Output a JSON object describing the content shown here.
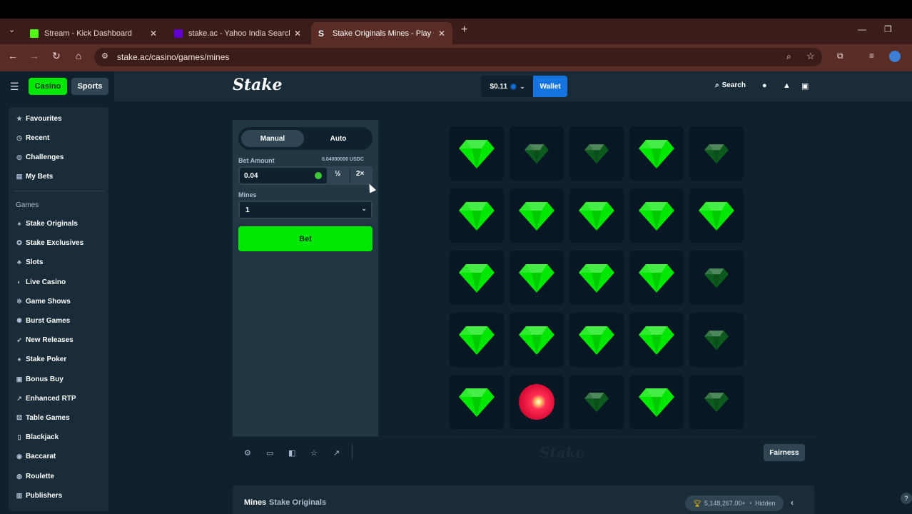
{
  "browser": {
    "tabs": [
      {
        "title": "Stream - Kick Dashboard",
        "favicon_color": "#53fc18",
        "active": false
      },
      {
        "title": "stake.ac - Yahoo India Search R",
        "favicon_color": "#6001d2",
        "active": false
      },
      {
        "title": "Stake Originals Mines - Play On",
        "favicon_color": "#ffffff",
        "active": true
      }
    ],
    "new_tab": "+",
    "url": "stake.ac/casino/games/mines"
  },
  "header": {
    "logo": "Stake",
    "balance": "$0.11",
    "wallet_label": "Wallet",
    "search_label": "Search"
  },
  "sidebar": {
    "top_buttons": [
      "Casino",
      "Sports"
    ],
    "quick": [
      {
        "label": "Favourites",
        "icon": "star-icon"
      },
      {
        "label": "Recent",
        "icon": "clock-icon"
      },
      {
        "label": "Challenges",
        "icon": "trophy-icon"
      },
      {
        "label": "My Bets",
        "icon": "list-icon"
      }
    ],
    "games_heading": "Games",
    "games": [
      {
        "label": "Stake Originals",
        "icon": "flame-icon"
      },
      {
        "label": "Stake Exclusives",
        "icon": "star-badge-icon"
      },
      {
        "label": "Slots",
        "icon": "cherry-icon"
      },
      {
        "label": "Live Casino",
        "icon": "headset-icon"
      },
      {
        "label": "Game Shows",
        "icon": "wheel-icon"
      },
      {
        "label": "Burst Games",
        "icon": "burst-icon"
      },
      {
        "label": "New Releases",
        "icon": "rocket-icon"
      },
      {
        "label": "Stake Poker",
        "icon": "spade-icon"
      },
      {
        "label": "Bonus Buy",
        "icon": "gift-icon"
      },
      {
        "label": "Enhanced RTP",
        "icon": "chart-icon"
      },
      {
        "label": "Table Games",
        "icon": "dice-icon"
      },
      {
        "label": "Blackjack",
        "icon": "cards-icon"
      },
      {
        "label": "Baccarat",
        "icon": "chip-icon"
      },
      {
        "label": "Roulette",
        "icon": "roulette-icon"
      },
      {
        "label": "Publishers",
        "icon": "building-icon"
      }
    ]
  },
  "controls": {
    "modes": [
      "Manual",
      "Auto"
    ],
    "active_mode": "Manual",
    "bet_amount_label": "Bet Amount",
    "bet_amount_usd": "0.04000000 USDC",
    "bet_value": "0.04",
    "half_label": "½",
    "double_label": "2×",
    "mines_label": "Mines",
    "mines_value": "1",
    "bet_button": "Bet"
  },
  "board": {
    "rows": [
      [
        "gem",
        "gem-dim",
        "gem-dim",
        "gem",
        "gem-dim"
      ],
      [
        "gem",
        "gem",
        "gem",
        "gem",
        "gem"
      ],
      [
        "gem",
        "gem",
        "gem",
        "gem",
        "gem-dim"
      ],
      [
        "gem",
        "gem",
        "gem",
        "gem",
        "gem-dim"
      ],
      [
        "gem",
        "mine",
        "gem-dim",
        "gem",
        "gem-dim"
      ]
    ],
    "gem_color": "#00e701",
    "gem_dim_color": "#0c5a1e",
    "mine_color": "#e0103a"
  },
  "footer": {
    "fairness_label": "Fairness",
    "watermark": "Stake"
  },
  "info": {
    "title": "Mines",
    "subtitle": "Stake Originals",
    "prize": "5,148,267.00+",
    "hidden_label": "Hidden"
  }
}
